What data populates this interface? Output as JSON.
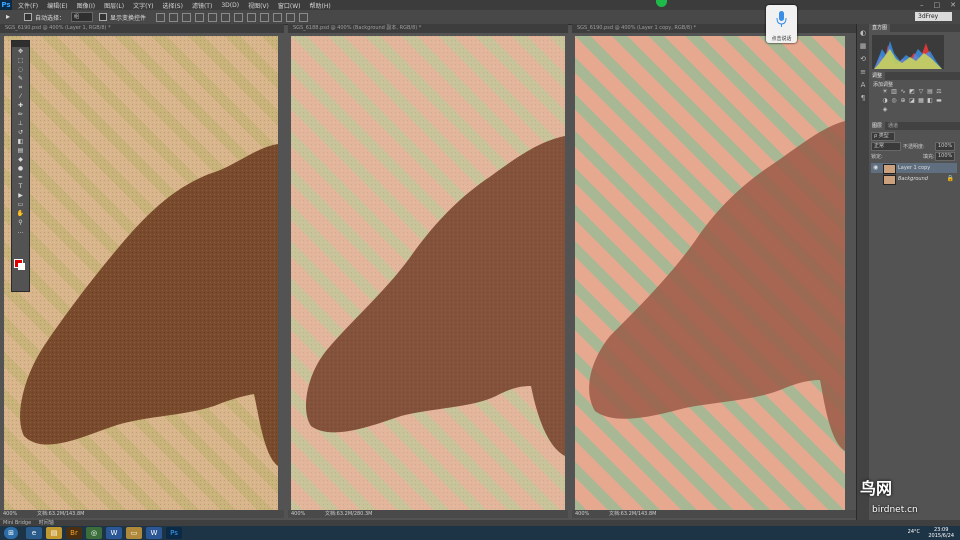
{
  "app": {
    "logo": "Ps"
  },
  "menu": [
    "文件(F)",
    "编辑(E)",
    "图像(I)",
    "图层(L)",
    "文字(Y)",
    "选择(S)",
    "滤镜(T)",
    "3D(D)",
    "视图(V)",
    "窗口(W)",
    "帮助(H)"
  ],
  "options_bar": {
    "auto_select_label": "自动选择：",
    "auto_select_value": "组",
    "show_transform_label": "显示变换控件"
  },
  "workspace": "3dFrey",
  "voice_widget": {
    "label": "点击说话"
  },
  "documents": [
    {
      "tab": "SGS_6190.psd @ 400% (Layer 1, RGB/8) *",
      "zoom": "400%",
      "doc_info": "文档:63.2M/143.8M"
    },
    {
      "tab": "SGS_6188.psd @ 400% (Background 副本, RGB/8) *",
      "zoom": "400%",
      "doc_info": "文档:63.2M/280.3M"
    },
    {
      "tab": "SGS_6190.psd @ 400% (Layer 1 copy, RGB/8) *",
      "zoom": "400%",
      "doc_info": "文档:63.2M/143.8M"
    }
  ],
  "panels": {
    "histogram_tab": "直方图",
    "adjustments_tab": "调整",
    "adjustments_title": "添加调整",
    "layers_tabs": [
      "图层",
      "通道"
    ],
    "kind_label": "ρ 类型",
    "blend_mode": "正常",
    "opacity_label": "不透明度:",
    "opacity_value": "100%",
    "lock_label": "锁定:",
    "fill_label": "填充:",
    "fill_value": "100%",
    "layers": [
      {
        "name": "Layer 1 copy",
        "visible": true
      },
      {
        "name": "Background",
        "visible": false,
        "locked": true
      }
    ]
  },
  "mini_bridge": {
    "label": "Mini Bridge",
    "timeline": "时间轴"
  },
  "taskbar": {
    "apps": [
      "ie-icon",
      "explorer-icon",
      "bridge-icon",
      "chrome-icon",
      "word-icon",
      "folder-icon",
      "word2-icon",
      "photoshop-icon"
    ],
    "tray_temp": "24°C",
    "clock_time": "23:09",
    "clock_date": "2015/6/24"
  },
  "watermark": {
    "text": "鸟网",
    "site": "birdnet.cn"
  }
}
